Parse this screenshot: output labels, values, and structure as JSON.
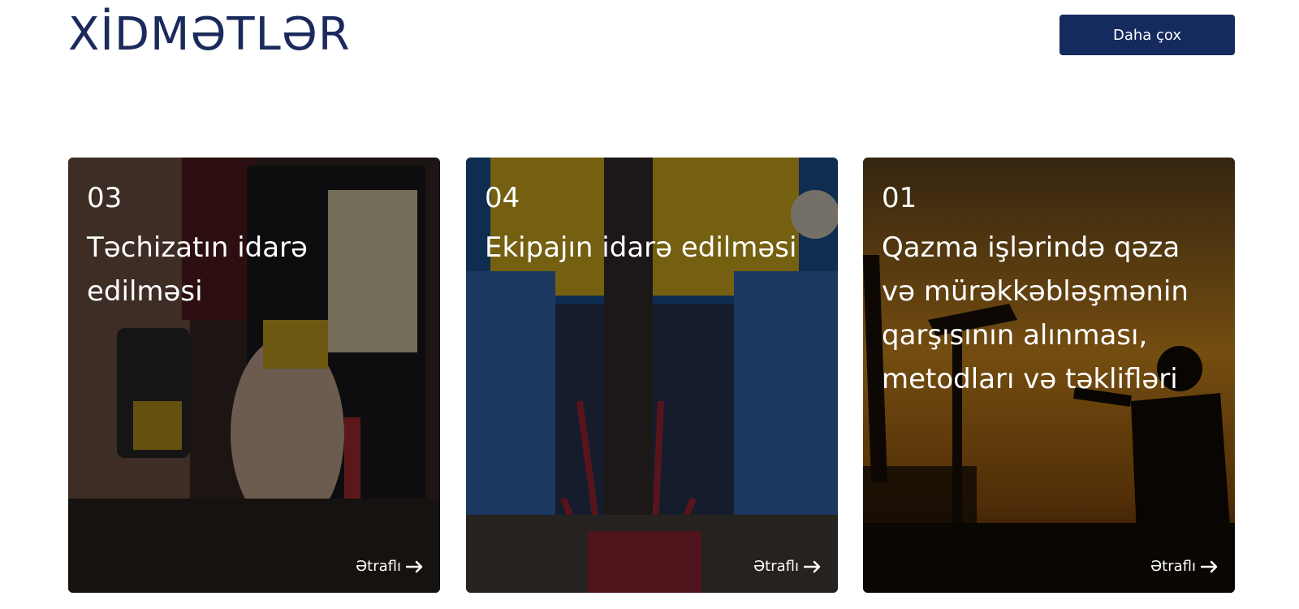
{
  "section": {
    "title": "XİDMƏTLƏR",
    "more_label": "Daha çox"
  },
  "cards": [
    {
      "number": "03",
      "title": "Təchizatın idarə edilməsi",
      "link_label": "Ətraflı"
    },
    {
      "number": "04",
      "title": "Ekipajın idarə edilməsi",
      "link_label": "Ətraflı"
    },
    {
      "number": "01",
      "title": "Qazma işlərində qəza və mürəkkəbləşmənin qarşısının alınması, metodları və təklifləri",
      "link_label": "Ətraflı"
    }
  ],
  "colors": {
    "brand": "#152a5e",
    "title": "#1b2a5c"
  },
  "icons": {
    "link_arrow": "arrow-right-icon"
  }
}
